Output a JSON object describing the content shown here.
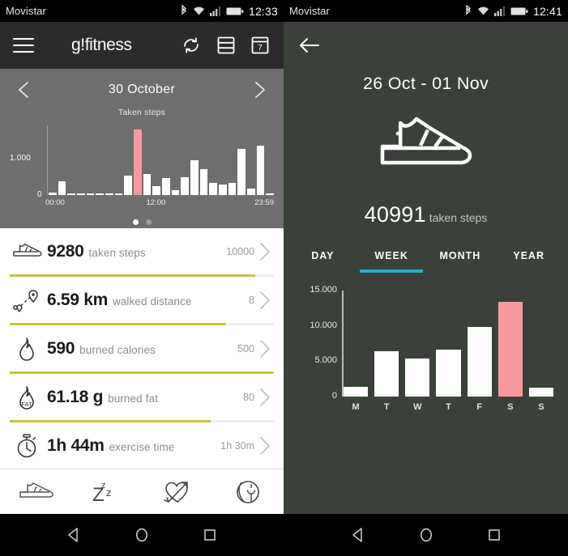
{
  "left": {
    "status": {
      "carrier": "Movistar",
      "time": "12:33",
      "icons": [
        "bluetooth-icon",
        "wifi-icon",
        "signal-icon",
        "battery-icon"
      ]
    },
    "appbar": {
      "menu": "menu-icon",
      "brand": "g!fitness",
      "actions": [
        "sync-icon",
        "list-icon",
        "calendar-7-icon"
      ]
    },
    "daypanel": {
      "prev": "chevron-left-icon",
      "next": "chevron-right-icon",
      "date": "30 October",
      "subtitle": "Taken steps",
      "page_dots": 2,
      "active_dot": 0
    },
    "metrics": [
      {
        "icon": "shoe-icon",
        "value": "9280",
        "label": "taken steps",
        "goal": "10000",
        "progress": 93
      },
      {
        "icon": "route-pin-icon",
        "value": "6.59 km",
        "label": "walked distance",
        "goal": "8",
        "progress": 82
      },
      {
        "icon": "flame-icon",
        "value": "590",
        "label": "burned calories",
        "goal": "500",
        "progress": 100
      },
      {
        "icon": "flame-fat-icon",
        "value": "61.18 g",
        "label": "burned fat",
        "goal": "80",
        "progress": 76
      },
      {
        "icon": "stopwatch-icon",
        "value": "1h 44m",
        "label": "exercise time",
        "goal": "1h 30m",
        "progress": 100
      }
    ],
    "tabbar": [
      "shoe-icon",
      "sleep-zzz-icon",
      "heart-arrow-icon",
      "globe-plant-icon"
    ]
  },
  "right": {
    "status": {
      "carrier": "Movistar",
      "time": "12:41",
      "icons": [
        "bluetooth-icon",
        "wifi-icon",
        "signal-icon",
        "battery-icon"
      ]
    },
    "back": "arrow-left-icon",
    "title": "26 Oct - 01 Nov",
    "hero_icon": "shoe-icon",
    "total_value": "40991",
    "total_label": "taken steps",
    "tabs": [
      {
        "label": "DAY",
        "active": false
      },
      {
        "label": "WEEK",
        "active": true
      },
      {
        "label": "MONTH",
        "active": false
      },
      {
        "label": "YEAR",
        "active": false
      }
    ]
  },
  "colors": {
    "accent_pink": "#f79aa0",
    "accent_blue": "#21b0e0",
    "progress_olive": "#c5c348",
    "dark_panel": "#3a4139",
    "chart_gray": "#6e6e6e",
    "appbar_dark": "#2b2b2b"
  },
  "android_nav": [
    "back-triangle-icon",
    "home-circle-icon",
    "recents-square-icon"
  ],
  "chart_data": [
    {
      "type": "bar",
      "title": "Taken steps",
      "subtitle": "30 October",
      "xlabel": "",
      "ylabel": "",
      "ylim": [
        0,
        1900
      ],
      "yticks": [
        0,
        1000
      ],
      "ytick_labels": [
        "0",
        "1.000"
      ],
      "xtick_labels": [
        "00:00",
        "12:00",
        "23:59"
      ],
      "categories": [
        "00",
        "01",
        "02",
        "03",
        "04",
        "05",
        "06",
        "07",
        "08",
        "09",
        "10",
        "11",
        "12",
        "13",
        "14",
        "15",
        "16",
        "17",
        "18",
        "19",
        "20",
        "21",
        "22",
        "23"
      ],
      "values": [
        70,
        380,
        55,
        55,
        55,
        55,
        55,
        55,
        530,
        1800,
        570,
        250,
        460,
        140,
        480,
        940,
        700,
        330,
        290,
        330,
        1270,
        170,
        1340,
        50
      ],
      "highlight_index": 9,
      "grid": false,
      "legend": false
    },
    {
      "type": "bar",
      "title": "",
      "xlabel": "",
      "ylabel": "",
      "ylim": [
        0,
        15000
      ],
      "yticks": [
        0,
        5000,
        10000,
        15000
      ],
      "ytick_labels": [
        "0",
        "5.000",
        "10.000",
        "15.000"
      ],
      "categories": [
        "M",
        "T",
        "W",
        "T",
        "F",
        "S",
        "S"
      ],
      "values": [
        1400,
        6400,
        5400,
        6700,
        9800,
        13400,
        1300
      ],
      "highlight_index": 5,
      "grid": false,
      "legend": false
    }
  ]
}
